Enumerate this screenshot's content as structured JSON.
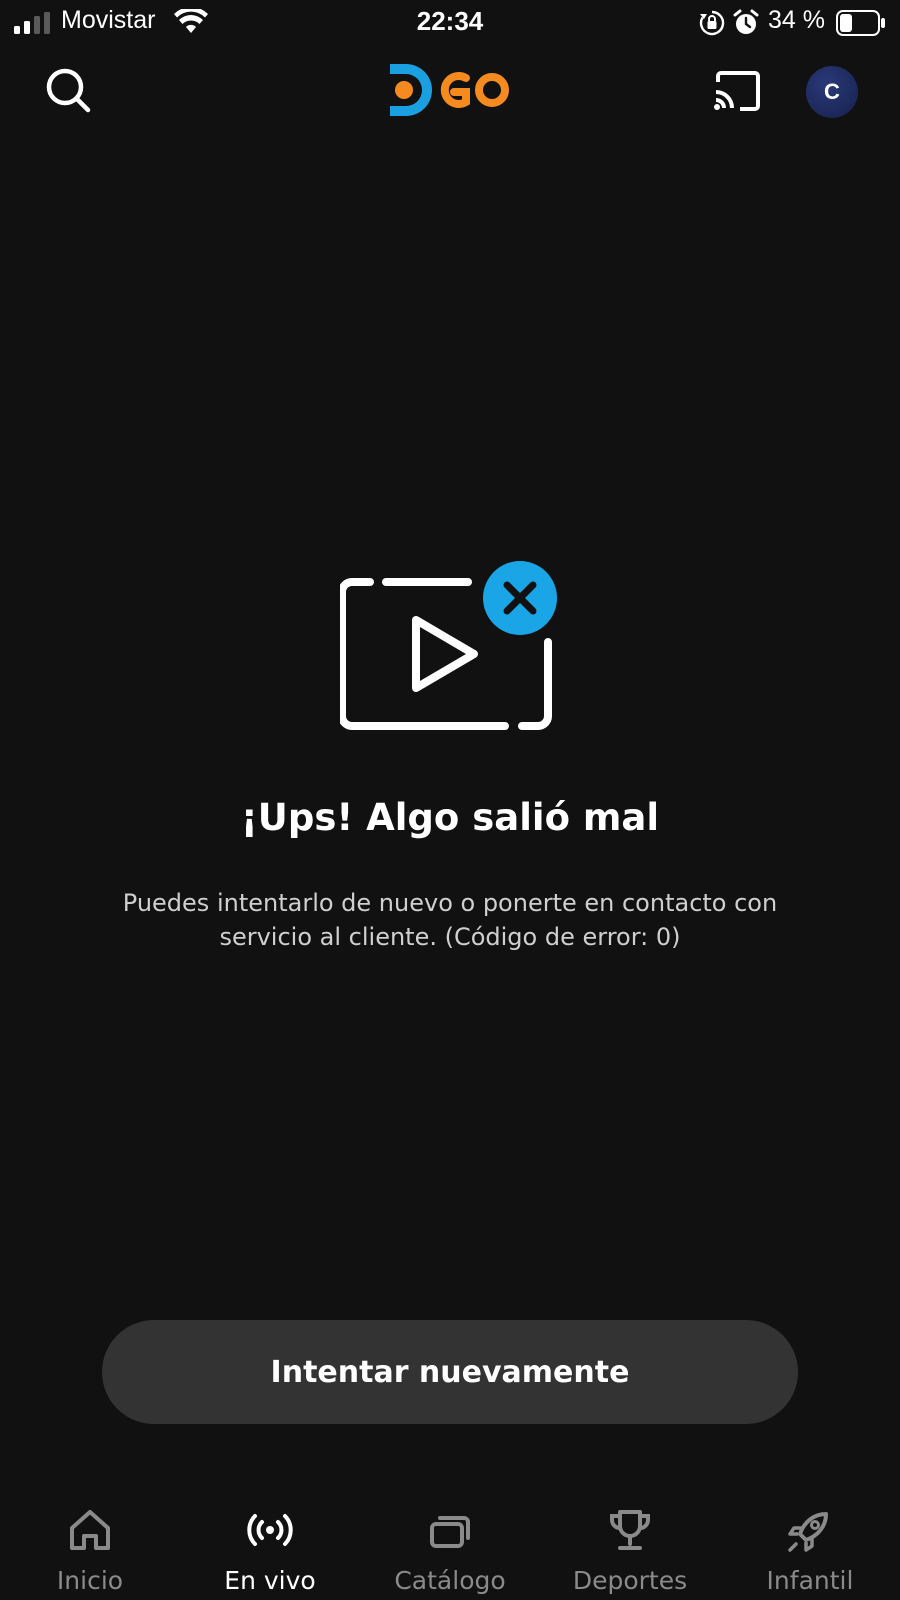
{
  "status_bar": {
    "carrier": "Movistar",
    "time": "22:34",
    "battery_percent": "34 %",
    "battery_level": 0.34,
    "signal_bars": 2
  },
  "header": {
    "logo_text": "DGO",
    "avatar_initial": "C",
    "icons": [
      "search-icon",
      "cast-icon"
    ]
  },
  "error": {
    "title": "¡Ups! Algo salió mal",
    "message": "Puedes intentarlo de nuevo o ponerte en contacto con servicio al cliente. (Código de error: 0)",
    "retry_label": "Intentar nuevamente"
  },
  "nav": {
    "items": [
      {
        "label": "Inicio",
        "icon": "home-icon",
        "active": false
      },
      {
        "label": "En vivo",
        "icon": "live-broadcast-icon",
        "active": true
      },
      {
        "label": "Catálogo",
        "icon": "catalog-icon",
        "active": false
      },
      {
        "label": "Deportes",
        "icon": "trophy-icon",
        "active": false
      },
      {
        "label": "Infantil",
        "icon": "rocket-icon",
        "active": false
      }
    ]
  },
  "colors": {
    "background": "#111111",
    "logo_blue": "#1a9fe0",
    "logo_orange": "#f58a1f",
    "error_badge": "#1aa5e6",
    "button_bg": "#333333",
    "nav_inactive": "#8a8a8a"
  }
}
